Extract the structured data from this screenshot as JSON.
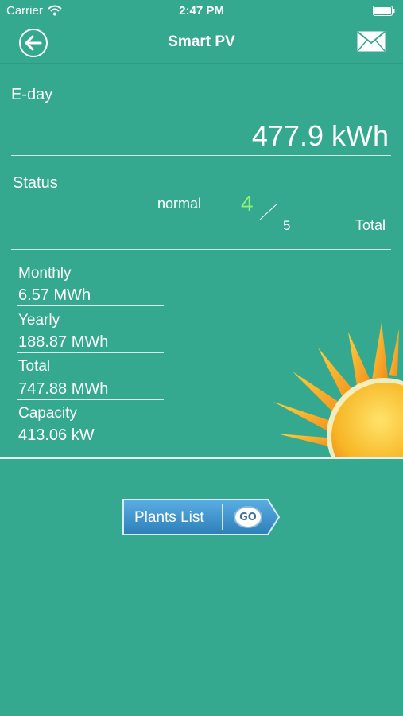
{
  "status_bar": {
    "carrier": "Carrier",
    "time": "2:47 PM"
  },
  "nav": {
    "title": "Smart PV"
  },
  "eday": {
    "label": "E-day",
    "value": "477.9 kWh"
  },
  "status": {
    "label": "Status",
    "normal_label": "normal",
    "normal_count": "4",
    "total_count": "5",
    "total_label": "Total"
  },
  "stats": {
    "monthly_label": "Monthly",
    "monthly_value": "6.57 MWh",
    "yearly_label": "Yearly",
    "yearly_value": "188.87 MWh",
    "total_label": "Total",
    "total_value": "747.88 MWh",
    "capacity_label": "Capacity",
    "capacity_value": "413.06 kW"
  },
  "plants_button": {
    "label": "Plants List",
    "go_label": "GO"
  },
  "colors": {
    "background": "#35a98f",
    "accent_green": "#8cf07a",
    "button_blue": "#3b8fc8"
  }
}
